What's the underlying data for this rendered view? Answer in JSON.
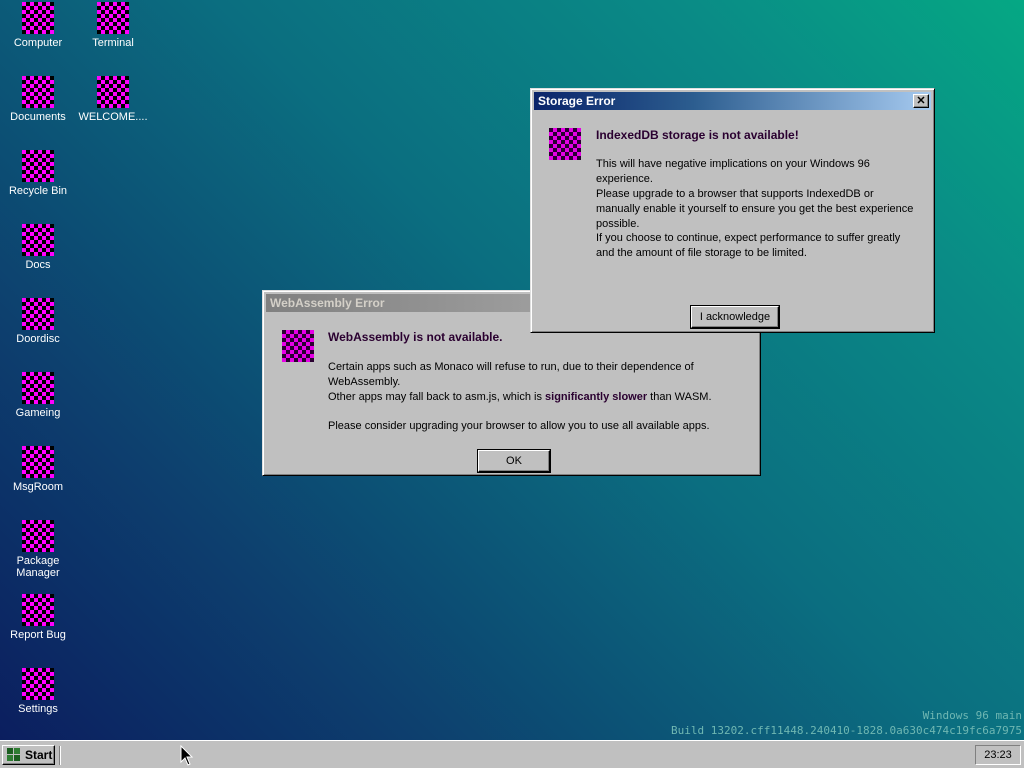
{
  "desktop_icons": [
    {
      "label": "Computer"
    },
    {
      "label": "Terminal"
    },
    {
      "label": "Documents"
    },
    {
      "label": "WELCOME...."
    },
    {
      "label": "Recycle Bin"
    },
    {
      "label": "Docs"
    },
    {
      "label": "Doordisc"
    },
    {
      "label": "Gameing"
    },
    {
      "label": "MsgRoom"
    },
    {
      "label": "Package\nManager"
    },
    {
      "label": "Report Bug"
    },
    {
      "label": "Settings"
    }
  ],
  "storage_dialog": {
    "title": "Storage Error",
    "close_glyph": "✕",
    "icon": "checker-icon",
    "heading": "IndexedDB storage is not available!",
    "line1": "This will have negative implications on your Windows 96 experience.",
    "line2": "Please upgrade to a browser that supports IndexedDB or manually enable it yourself to ensure you get the best experience possible.",
    "line3": "If you choose to continue, expect performance to suffer greatly and the amount of file storage to be limited.",
    "button": "I acknowledge"
  },
  "wasm_dialog": {
    "title": "WebAssembly Error",
    "icon": "checker-icon",
    "heading": "WebAssembly is not available.",
    "line1": "Certain apps such as Monaco will refuse to run, due to their dependence of WebAssembly.",
    "line2_pre": "Other apps may fall back to asm.js, which is ",
    "line2_bold": "significantly slower",
    "line2_post": " than WASM.",
    "line3": "Please consider upgrading your browser to allow you to use all available apps.",
    "button": "OK"
  },
  "watermark": {
    "line1": "Windows 96 main",
    "line2": "Build 13202.cff11448.240410-1828.0a630c474c19fc6a7975"
  },
  "taskbar": {
    "start_label": "Start",
    "clock": "23:23"
  },
  "colors": {
    "accent_pink": "#ff00ff",
    "title_active": "#0a246a",
    "window_face": "#c0c0c0"
  }
}
